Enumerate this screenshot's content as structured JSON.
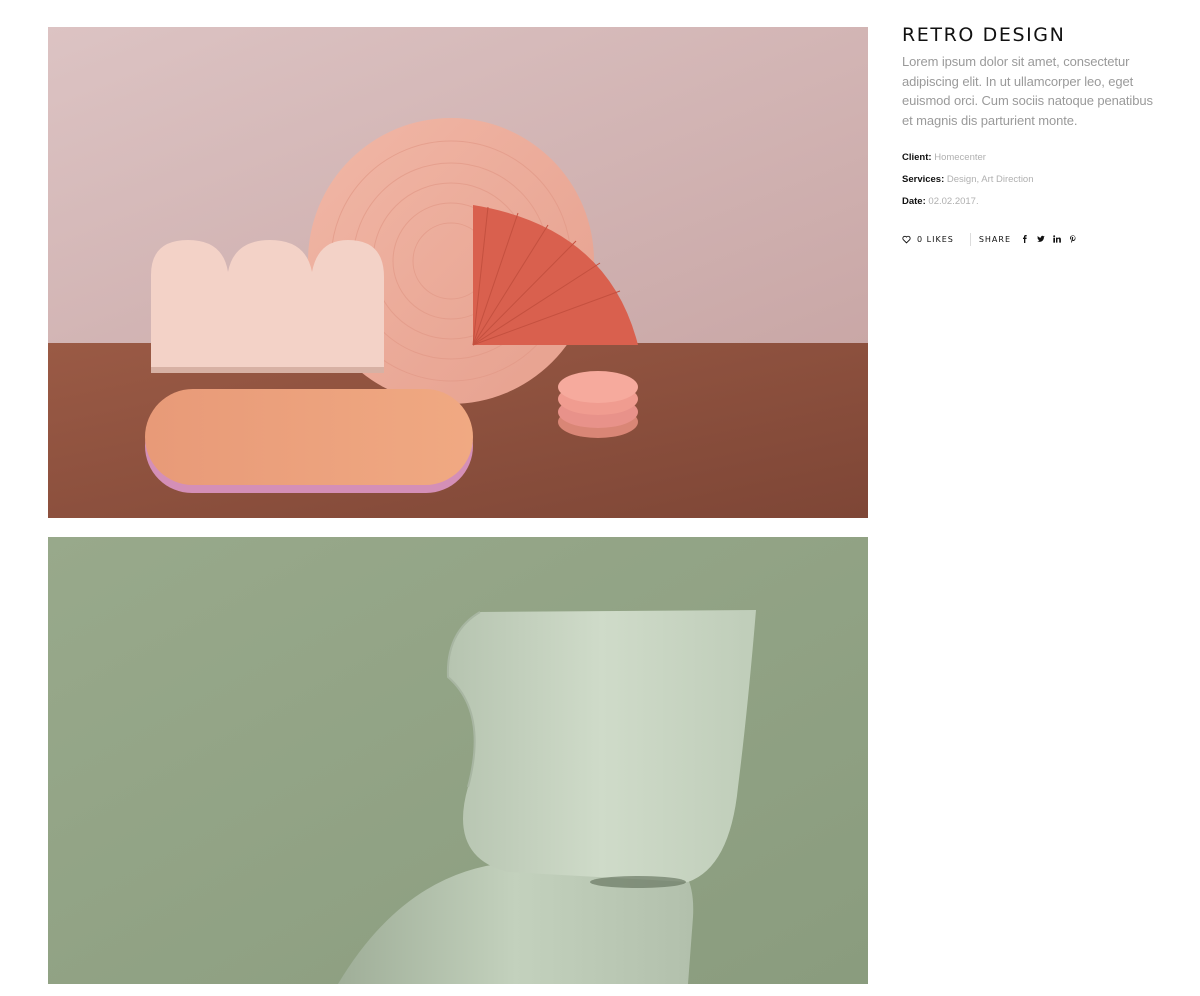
{
  "project": {
    "title": "RETRO DESIGN",
    "description": "Lorem ipsum dolor sit amet, consectetur adipiscing elit. In ut ullamcorper leo, eget euismod orci. Cum sociis natoque penatibus et magnis dis parturient monte."
  },
  "meta": {
    "client_key": "Client:",
    "client_value": "Homecenter",
    "services_key": "Services:",
    "services_value": "Design, Art Direction",
    "date_key": "Date:",
    "date_value": "02.02.2017."
  },
  "actions": {
    "likes_label": "0 LIKES",
    "share_label": "SHARE",
    "social_icons": [
      "facebook-icon",
      "twitter-icon",
      "linkedin-icon",
      "pinterest-icon"
    ]
  },
  "gallery": {
    "images": [
      "retro-shapes-photo",
      "green-chair-photo"
    ]
  },
  "colors": {
    "accent_text": "#111111",
    "muted_text": "#9a9a9a",
    "photo1_wall": "#d9b8b6",
    "photo1_floor": "#8e4f3e",
    "photo2_bg": "#94a587",
    "chair": "#c5d3c0"
  }
}
